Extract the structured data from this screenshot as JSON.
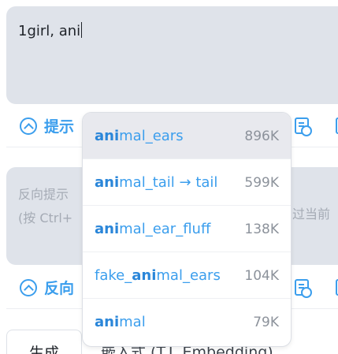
{
  "prompt": {
    "value": "1girl, ani"
  },
  "prompt_toolbar": {
    "label": "提示",
    "icons": [
      "expand-toggle-icon",
      "prompt-history-icon",
      "image-icon"
    ]
  },
  "negative_prompt": {
    "placeholder_line1": "反向提示",
    "placeholder_line2": "(按 Ctrl+",
    "placeholder_tail": "过当前"
  },
  "negative_toolbar": {
    "label": "反向"
  },
  "tabs": {
    "active": "生成",
    "inactive": "嵌入式 (T.I. Embedding)"
  },
  "autocomplete": {
    "query": "ani",
    "items": [
      {
        "pre": "",
        "match": "ani",
        "post": "mal_ears",
        "count": "896K",
        "highlighted": true
      },
      {
        "pre": "",
        "match": "ani",
        "post": "mal_tail → tail",
        "count": "599K",
        "highlighted": false
      },
      {
        "pre": "",
        "match": "ani",
        "post": "mal_ear_fluff",
        "count": "138K",
        "highlighted": false
      },
      {
        "pre": "fake_",
        "match": "ani",
        "post": "mal_ears",
        "count": "104K",
        "highlighted": false
      },
      {
        "pre": "",
        "match": "ani",
        "post": "mal",
        "count": "79K",
        "highlighted": false
      }
    ]
  },
  "colors": {
    "accent": "#3b9eed",
    "textarea_bg": "#dfe3ea",
    "highlight_row": "#e8e9ee"
  }
}
